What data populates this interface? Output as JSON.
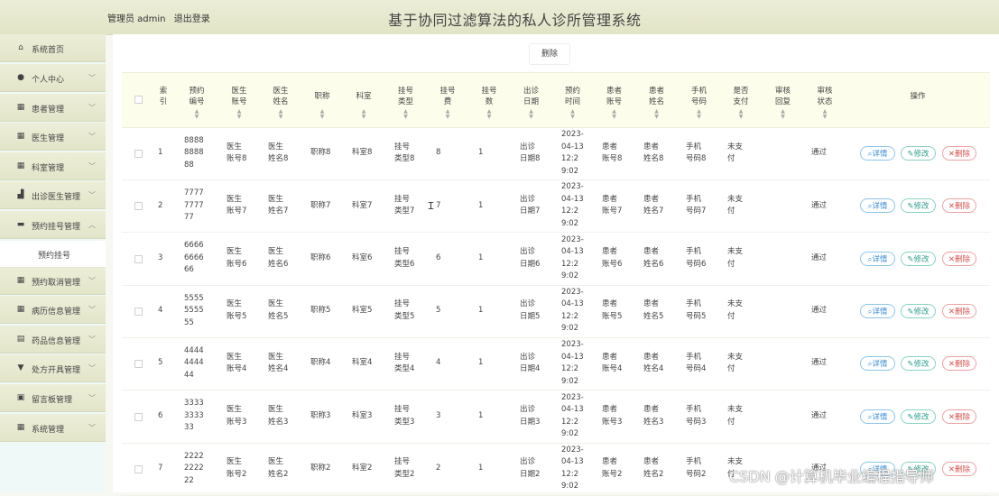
{
  "header": {
    "role": "管理员 admin",
    "logout": "退出登录",
    "title": "基于协同过滤算法的私人诊所管理系统"
  },
  "sidebar": {
    "items": [
      {
        "label": "系统首页",
        "icon": "home-icon",
        "glyph": "⌂",
        "chevron": false
      },
      {
        "label": "个人中心",
        "icon": "user-icon",
        "glyph": "●",
        "chevron": true
      },
      {
        "label": "患者管理",
        "icon": "grid-icon",
        "glyph": "▦",
        "chevron": true
      },
      {
        "label": "医生管理",
        "icon": "grid-icon",
        "glyph": "▦",
        "chevron": true
      },
      {
        "label": "科室管理",
        "icon": "grid-icon",
        "glyph": "▦",
        "chevron": true
      },
      {
        "label": "出诊医生管理",
        "icon": "thumb-icon",
        "glyph": "▟",
        "chevron": true
      },
      {
        "label": "预约挂号管理",
        "icon": "monitor-icon",
        "glyph": "▬",
        "chevron": true,
        "expanded": true
      },
      {
        "label": "预约取消管理",
        "icon": "grid-icon",
        "glyph": "▦",
        "chevron": true
      },
      {
        "label": "病历信息管理",
        "icon": "grid-icon",
        "glyph": "▦",
        "chevron": true
      },
      {
        "label": "药品信息管理",
        "icon": "list-icon",
        "glyph": "▤",
        "chevron": true
      },
      {
        "label": "处方开具管理",
        "icon": "trophy-icon",
        "glyph": "▼",
        "chevron": true
      },
      {
        "label": "留言板管理",
        "icon": "clipboard-icon",
        "glyph": "▣",
        "chevron": true
      },
      {
        "label": "系统管理",
        "icon": "grid-icon",
        "glyph": "▦",
        "chevron": true
      }
    ],
    "submenu_label": "预约挂号"
  },
  "toolbar": {
    "delete_label": "删除"
  },
  "table": {
    "columns": [
      "索\n引",
      "预约\n编号",
      "医生\n账号",
      "医生\n姓名",
      "职称",
      "科室",
      "挂号\n类型",
      "挂号\n费",
      "挂号\n数",
      "出诊\n日期",
      "预约\n时间",
      "患者\n账号",
      "患者\n姓名",
      "手机\n号码",
      "是否\n支付",
      "审核\n回复",
      "审核\n状态",
      "操作"
    ],
    "rows": [
      {
        "idx": "1",
        "code": "8888\n8888\n88",
        "doc_acc": "医生\n账号8",
        "doc_name": "医生\n姓名8",
        "title": "职称8",
        "dept": "科室8",
        "type": "挂号\n类型8",
        "fee": "8",
        "count": "1",
        "date": "出诊\n日期8",
        "time": "2023-\n04-13\n12:2\n9:02",
        "pat_acc": "患者\n账号8",
        "pat_name": "患者\n姓名8",
        "phone": "手机\n号码8",
        "paid": "未支\n付",
        "reply": "",
        "status": "通过"
      },
      {
        "idx": "2",
        "code": "7777\n7777\n77",
        "doc_acc": "医生\n账号7",
        "doc_name": "医生\n姓名7",
        "title": "职称7",
        "dept": "科室7",
        "type": "挂号\n类型7",
        "fee": "7",
        "count": "1",
        "date": "出诊\n日期7",
        "time": "2023-\n04-13\n12:2\n9:02",
        "pat_acc": "患者\n账号7",
        "pat_name": "患者\n姓名7",
        "phone": "手机\n号码7",
        "paid": "未支\n付",
        "reply": "",
        "status": "通过"
      },
      {
        "idx": "3",
        "code": "6666\n6666\n66",
        "doc_acc": "医生\n账号6",
        "doc_name": "医生\n姓名6",
        "title": "职称6",
        "dept": "科室6",
        "type": "挂号\n类型6",
        "fee": "6",
        "count": "1",
        "date": "出诊\n日期6",
        "time": "2023-\n04-13\n12:2\n9:02",
        "pat_acc": "患者\n账号6",
        "pat_name": "患者\n姓名6",
        "phone": "手机\n号码6",
        "paid": "未支\n付",
        "reply": "",
        "status": "通过"
      },
      {
        "idx": "4",
        "code": "5555\n5555\n55",
        "doc_acc": "医生\n账号5",
        "doc_name": "医生\n姓名5",
        "title": "职称5",
        "dept": "科室5",
        "type": "挂号\n类型5",
        "fee": "5",
        "count": "1",
        "date": "出诊\n日期5",
        "time": "2023-\n04-13\n12:2\n9:02",
        "pat_acc": "患者\n账号5",
        "pat_name": "患者\n姓名5",
        "phone": "手机\n号码5",
        "paid": "未支\n付",
        "reply": "",
        "status": "通过"
      },
      {
        "idx": "5",
        "code": "4444\n4444\n44",
        "doc_acc": "医生\n账号4",
        "doc_name": "医生\n姓名4",
        "title": "职称4",
        "dept": "科室4",
        "type": "挂号\n类型4",
        "fee": "4",
        "count": "1",
        "date": "出诊\n日期4",
        "time": "2023-\n04-13\n12:2\n9:02",
        "pat_acc": "患者\n账号4",
        "pat_name": "患者\n姓名4",
        "phone": "手机\n号码4",
        "paid": "未支\n付",
        "reply": "",
        "status": "通过"
      },
      {
        "idx": "6",
        "code": "3333\n3333\n33",
        "doc_acc": "医生\n账号3",
        "doc_name": "医生\n姓名3",
        "title": "职称3",
        "dept": "科室3",
        "type": "挂号\n类型3",
        "fee": "3",
        "count": "1",
        "date": "出诊\n日期3",
        "time": "2023-\n04-13\n12:2\n9:02",
        "pat_acc": "患者\n账号3",
        "pat_name": "患者\n姓名3",
        "phone": "手机\n号码3",
        "paid": "未支\n付",
        "reply": "",
        "status": "通过"
      },
      {
        "idx": "7",
        "code": "2222\n2222\n22",
        "doc_acc": "医生\n账号2",
        "doc_name": "医生\n姓名2",
        "title": "职称2",
        "dept": "科室2",
        "type": "挂号\n类型2",
        "fee": "2",
        "count": "1",
        "date": "出诊\n日期2",
        "time": "2023-\n04-13\n12:2\n9:02",
        "pat_acc": "患者\n账号2",
        "pat_name": "患者\n姓名2",
        "phone": "手机\n号码2",
        "paid": "未支\n付",
        "reply": "",
        "status": "通过"
      }
    ],
    "actions": {
      "detail": "详情",
      "edit": "修改",
      "delete": "删除"
    }
  },
  "watermark": "CSDN @计算机毕业编程指导师",
  "colors": {
    "header_bg": "#e2e4c6",
    "table_head_bg": "#fdfdec",
    "detail": "#3a8ed6",
    "edit": "#2f9f8e",
    "delete": "#d9534f"
  }
}
